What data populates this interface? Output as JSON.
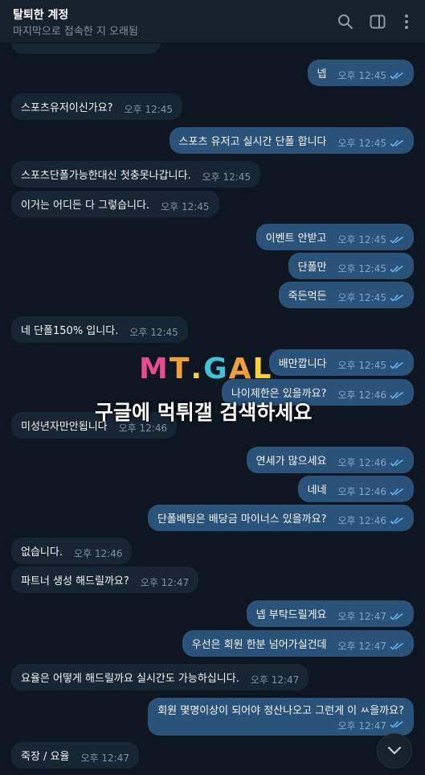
{
  "header": {
    "title": "탈퇴한 계정",
    "status": "마지막으로 접속한 지 오래됨"
  },
  "watermark": {
    "logo": "MT.GAL",
    "text": "구글에 먹튀갤 검색하세요"
  },
  "messages": [
    {
      "dir": "out",
      "text": "넵",
      "time": "오후 12:45",
      "read": true
    },
    {
      "dir": "in",
      "text": "스포츠유저이신가요?",
      "time": "오후 12:45"
    },
    {
      "dir": "out",
      "text": "스포츠 유저고 실시간 단폴 합니다",
      "time": "오후 12:45",
      "read": true
    },
    {
      "dir": "in",
      "text": "스포츠단폴가능한대신 첫충못나갑니다.",
      "time": "오후 12:45"
    },
    {
      "dir": "in",
      "text": "이거는 어디든 다 그렇습니다.",
      "time": "오후 12:45"
    },
    {
      "dir": "out",
      "text": "이벤트 안받고",
      "time": "오후 12:45",
      "read": true
    },
    {
      "dir": "out",
      "text": "단폴만",
      "time": "오후 12:45",
      "read": true
    },
    {
      "dir": "out",
      "text": "죽든먹든",
      "time": "오후 12:45",
      "read": true
    },
    {
      "dir": "in",
      "text": "네 단폴150% 입니다.",
      "time": "오후 12:45"
    },
    {
      "dir": "out",
      "text": "배만깝니다",
      "time": "오후 12:45",
      "read": true
    },
    {
      "dir": "out",
      "text": "나이제한은 있을까요?",
      "time": "오후 12:46",
      "read": true
    },
    {
      "dir": "in",
      "text": "미성년자만안됩니다",
      "time": "오후 12:46"
    },
    {
      "dir": "out",
      "text": "연세가 많으세요",
      "time": "오후 12:46",
      "read": true
    },
    {
      "dir": "out",
      "text": "네네",
      "time": "오후 12:46",
      "read": true
    },
    {
      "dir": "out",
      "text": "단폴배팅은 배당금 마이너스 있을까요?",
      "time": "오후 12:46",
      "read": true
    },
    {
      "dir": "in",
      "text": "없습니다.",
      "time": "오후 12:46"
    },
    {
      "dir": "in",
      "text": "파트너 생성 해드릴까요?",
      "time": "오후 12:47"
    },
    {
      "dir": "out",
      "text": "넵 부탁드릴게요",
      "time": "오후 12:47",
      "read": true
    },
    {
      "dir": "out",
      "text": "우선은 회원 한분 넘어가실건데",
      "time": "오후 12:47",
      "read": true
    },
    {
      "dir": "in",
      "text": "요율은 어떻게 해드릴까요 실시간도 가능하십니다.",
      "time": "오후 12:47"
    },
    {
      "dir": "out",
      "text": "회원 몇명이상이 되어야 정산나오고 그런게 이 ㅆ을까요?",
      "time": "오후 12:47",
      "read": true
    },
    {
      "dir": "in",
      "text": "죽장 / 요율",
      "time": "오후 12:47"
    }
  ]
}
